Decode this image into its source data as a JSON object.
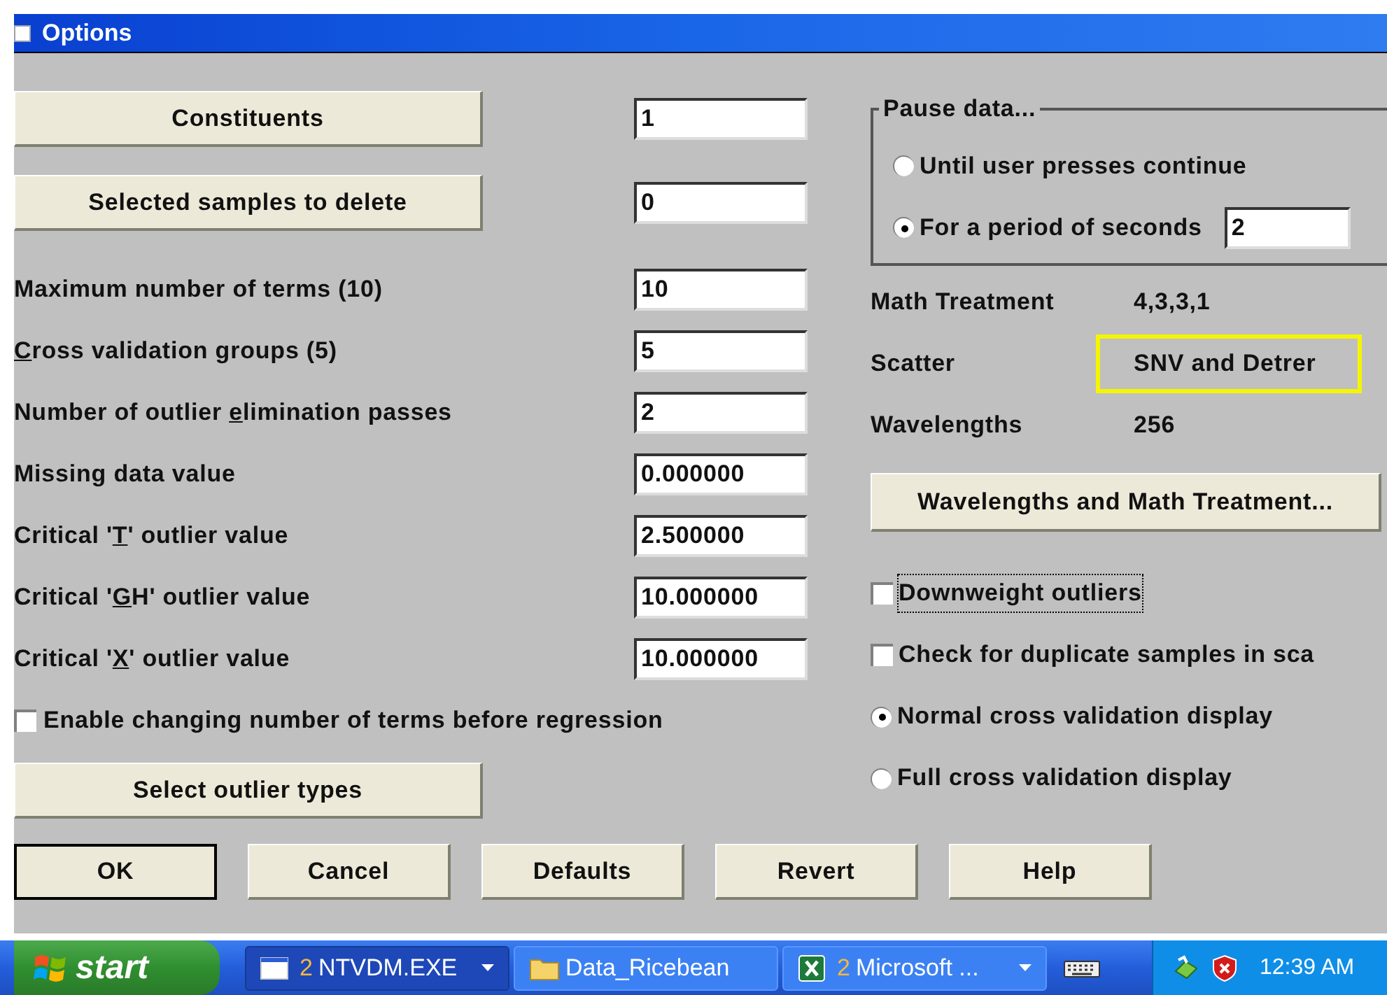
{
  "window": {
    "title": "Options"
  },
  "left_rows": [
    {
      "kind": "button_field",
      "button": "Constituents",
      "value": "1"
    },
    {
      "kind": "button_field",
      "button": "Selected samples to delete",
      "value": "0"
    },
    {
      "kind": "field",
      "label": {
        "before": "Maximum number of terms (10)"
      },
      "value": "10"
    },
    {
      "kind": "field",
      "label": {
        "key": "C",
        "after": "ross validation groups (5)"
      },
      "value": "5"
    },
    {
      "kind": "field",
      "label": {
        "before": "Number of outlier ",
        "key": "e",
        "after": "limination passes"
      },
      "value": "2"
    },
    {
      "kind": "field",
      "label": {
        "before": "Missing data value"
      },
      "value": "0.000000"
    },
    {
      "kind": "field",
      "label": {
        "before": "Critical '",
        "key": "T",
        "after": "' outlier value"
      },
      "value": "2.500000"
    },
    {
      "kind": "field",
      "label": {
        "before": "Critical '",
        "key": "G",
        "after": "H' outlier value"
      },
      "value": "10.000000"
    },
    {
      "kind": "field",
      "label": {
        "before": "Critical '",
        "key": "X",
        "after": "' outlier value"
      },
      "value": "10.000000"
    },
    {
      "kind": "checkbox",
      "label": {
        "before": "Enable changing number of terms before regression"
      },
      "checked": false,
      "focused": false
    },
    {
      "kind": "button",
      "button": "Select outlier types"
    }
  ],
  "pause_group": {
    "title": "Pause data...",
    "options": [
      {
        "label": "Until user presses continue",
        "selected": false
      },
      {
        "label": "For a period of seconds",
        "selected": true,
        "value": "2"
      }
    ]
  },
  "info": [
    {
      "label": "Math Treatment",
      "value": "4,3,3,1",
      "highlighted": false
    },
    {
      "label": "Scatter",
      "value": "SNV and Detrer",
      "highlighted": true
    },
    {
      "label": "Wavelengths",
      "value": "256",
      "highlighted": false
    }
  ],
  "treatment_button": "Wavelengths and Math Treatment...",
  "right_options": [
    {
      "kind": "checkbox",
      "label": "Downweight outliers",
      "checked": false,
      "focused": true
    },
    {
      "kind": "checkbox",
      "label": "Check for duplicate samples in sca",
      "checked": false,
      "focused": false
    },
    {
      "kind": "radio",
      "label": "Normal cross validation display",
      "selected": true
    },
    {
      "kind": "radio",
      "label": "Full cross validation display",
      "selected": false
    }
  ],
  "buttons": [
    {
      "label": "OK",
      "default": true
    },
    {
      "label": "Cancel",
      "default": false
    },
    {
      "label": "Defaults",
      "default": false
    },
    {
      "label": "Revert",
      "default": false
    },
    {
      "label": "Help",
      "default": false
    }
  ],
  "taskbar": {
    "start": "start",
    "tasks": [
      {
        "kind": "window",
        "count": "2",
        "label": "NTVDM.EXE",
        "selected": true,
        "has_menu": true
      },
      {
        "kind": "folder",
        "label": "Data_Ricebean",
        "selected": false,
        "has_menu": false
      },
      {
        "kind": "excel",
        "count": "2",
        "label": "Microsoft ...",
        "selected": false,
        "has_menu": true
      }
    ],
    "time": "12:39 AM"
  }
}
